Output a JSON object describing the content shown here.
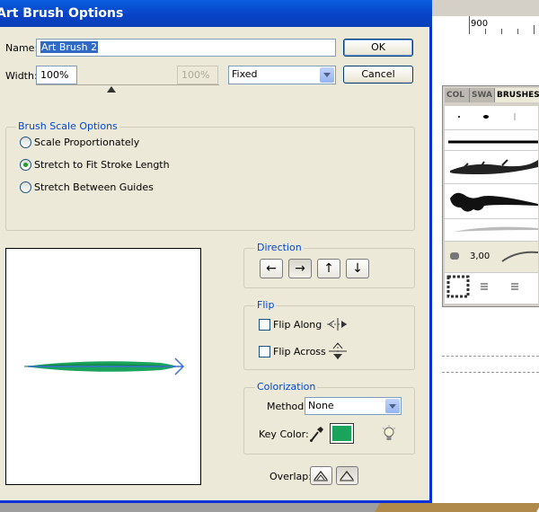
{
  "dialog": {
    "title": "Art Brush Options",
    "name_label": "Name:",
    "name_value": "Art Brush 2",
    "width_label": "Width:",
    "width_value": "100%",
    "width_secondary_value": "100%",
    "width_mode": "Fixed",
    "ok_label": "OK",
    "cancel_label": "Cancel"
  },
  "brush_scale": {
    "title": "Brush Scale Options",
    "options": [
      "Scale Proportionately",
      "Stretch to Fit Stroke Length",
      "Stretch Between Guides"
    ],
    "selected_index": 1
  },
  "direction": {
    "title": "Direction",
    "buttons": [
      "←",
      "→",
      "↑",
      "↓"
    ],
    "selected_index": 1
  },
  "flip": {
    "title": "Flip",
    "along_label": "Flip Along",
    "across_label": "Flip Across"
  },
  "colorization": {
    "title": "Colorization",
    "method_label": "Method:",
    "method_value": "None",
    "key_color_label": "Key Color:",
    "key_color": "#1aa35a"
  },
  "overlap": {
    "label": "Overlap:"
  },
  "background_app": {
    "ruler_label": "900",
    "panel_tabs": [
      "COL",
      "SWA",
      "BRUSHES"
    ],
    "stroke_weight": "3,00"
  },
  "colors": {
    "title_bar": "#0842c7",
    "accent": "#0046d5",
    "brush_green": "#1aa35a",
    "arrow_blue": "#3b6fd4"
  }
}
